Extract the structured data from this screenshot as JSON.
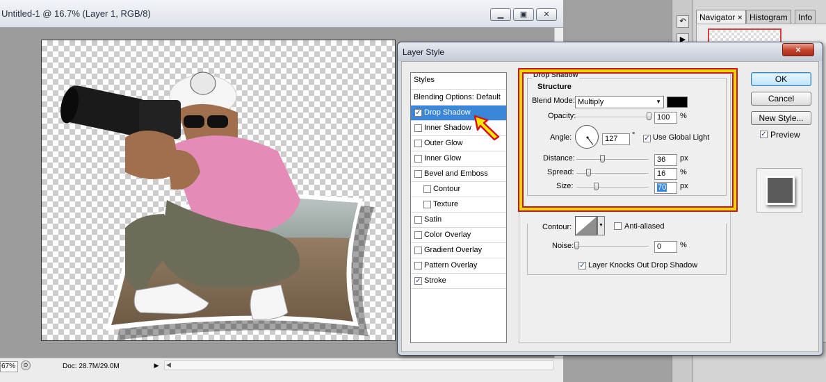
{
  "document": {
    "title": "Untitled-1 @ 16.7% (Layer 1, RGB/8)",
    "window_buttons": [
      "minimize",
      "restore",
      "close"
    ],
    "status": {
      "zoom": "67%",
      "doc_size": "Doc: 28.7M/29.0M"
    }
  },
  "right_panel": {
    "tabs": [
      {
        "label": "Navigator ×",
        "active": true
      },
      {
        "label": "Histogram",
        "active": false
      },
      {
        "label": "Info",
        "active": false
      }
    ]
  },
  "dialog": {
    "title": "Layer Style",
    "close_label": "×",
    "styles_list": [
      {
        "label": "Styles",
        "checkbox": false,
        "checked": false,
        "selected": false
      },
      {
        "label": "Blending Options: Default",
        "checkbox": false,
        "checked": false,
        "selected": false
      },
      {
        "label": "Drop Shadow",
        "checkbox": true,
        "checked": true,
        "selected": true
      },
      {
        "label": "Inner Shadow",
        "checkbox": true,
        "checked": false,
        "selected": false
      },
      {
        "label": "Outer Glow",
        "checkbox": true,
        "checked": false,
        "selected": false
      },
      {
        "label": "Inner Glow",
        "checkbox": true,
        "checked": false,
        "selected": false
      },
      {
        "label": "Bevel and Emboss",
        "checkbox": true,
        "checked": false,
        "selected": false
      },
      {
        "label": "Contour",
        "checkbox": true,
        "checked": false,
        "selected": false,
        "sub": true
      },
      {
        "label": "Texture",
        "checkbox": true,
        "checked": false,
        "selected": false,
        "sub": true
      },
      {
        "label": "Satin",
        "checkbox": true,
        "checked": false,
        "selected": false
      },
      {
        "label": "Color Overlay",
        "checkbox": true,
        "checked": false,
        "selected": false
      },
      {
        "label": "Gradient Overlay",
        "checkbox": true,
        "checked": false,
        "selected": false
      },
      {
        "label": "Pattern Overlay",
        "checkbox": true,
        "checked": false,
        "selected": false
      },
      {
        "label": "Stroke",
        "checkbox": true,
        "checked": true,
        "selected": false
      }
    ],
    "drop_shadow": {
      "section_title": "Drop Shadow",
      "structure_title": "Structure",
      "blend_mode_label": "Blend Mode:",
      "blend_mode_value": "Multiply",
      "shadow_color": "#000000",
      "opacity_label": "Opacity:",
      "opacity_value": "100",
      "opacity_unit": "%",
      "opacity_level": 1.0,
      "angle_label": "Angle:",
      "angle_value": "127",
      "angle_unit": "°",
      "use_global_light_label": "Use Global Light",
      "use_global_light": true,
      "distance_label": "Distance:",
      "distance_value": "36",
      "distance_unit": "px",
      "distance_level": 0.36,
      "spread_label": "Spread:",
      "spread_value": "16",
      "spread_unit": "%",
      "spread_level": 0.16,
      "size_label": "Size:",
      "size_value": "70",
      "size_unit": "px",
      "size_level": 0.27,
      "contour_label": "Contour:",
      "anti_aliased_label": "Anti-aliased",
      "anti_aliased": false,
      "noise_label": "Noise:",
      "noise_value": "0",
      "noise_unit": "%",
      "noise_level": 0.0,
      "knockout_label": "Layer Knocks Out Drop Shadow",
      "knockout": true
    },
    "buttons": {
      "ok": "OK",
      "cancel": "Cancel",
      "new_style": "New Style...",
      "preview_label": "Preview",
      "preview_checked": true
    },
    "highlight_color": "#e8d800",
    "selection_color": "#3a86d9"
  }
}
